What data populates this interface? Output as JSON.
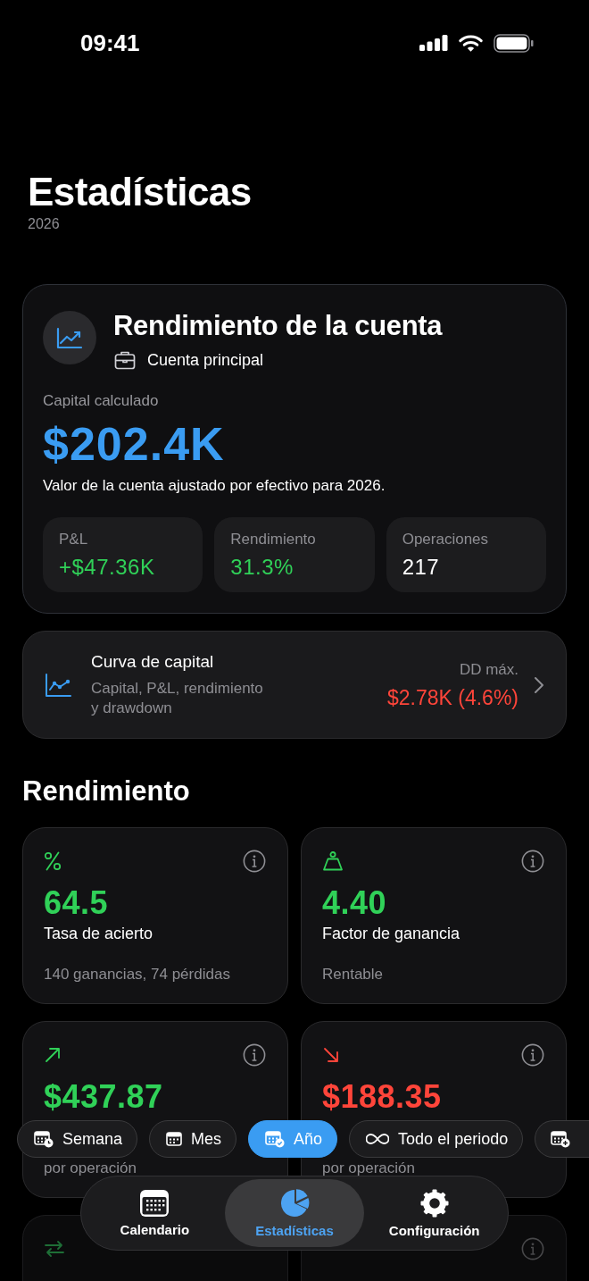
{
  "status_bar": {
    "time": "09:41"
  },
  "header": {
    "title": "Estadísticas",
    "subtitle": "2026"
  },
  "account_card": {
    "title": "Rendimiento de la cuenta",
    "account": "Cuenta principal",
    "capital_label": "Capital calculado",
    "capital_value": "$202.4K",
    "description": "Valor de la cuenta ajustado por efectivo para 2026.",
    "stats": [
      {
        "label": "P&L",
        "value": "+$47.36K",
        "color": "#30d158"
      },
      {
        "label": "Rendimiento",
        "value": "31.3%",
        "color": "#30d158"
      },
      {
        "label": "Operaciones",
        "value": "217",
        "color": "#ffffff"
      }
    ]
  },
  "equity_curve_card": {
    "title": "Curva de capital",
    "subtitle": "Capital, P&L, rendimiento y drawdown",
    "metric_label": "DD máx.",
    "metric_value": "$2.78K (4.6%)"
  },
  "section_title": "Rendimiento",
  "metrics": [
    {
      "kind": "percent",
      "color": "#30d158",
      "value": "64.5",
      "label": "Tasa de acierto",
      "detail": "140 ganancias, 74 pérdidas",
      "info": true
    },
    {
      "kind": "scale",
      "color": "#30d158",
      "value": "4.40",
      "label": "Factor de ganancia",
      "detail": "Rentable",
      "info": true
    },
    {
      "kind": "arrow_up",
      "color": "#30d158",
      "value": "$437.87",
      "detail": "por operación",
      "info": true
    },
    {
      "kind": "arrow_down",
      "color": "#ff453a",
      "value": "$188.35",
      "detail": "por operación",
      "info": true
    },
    {
      "kind": "swap",
      "color": "#1e6e36",
      "info": false
    },
    {
      "info": true
    }
  ],
  "period_filter": [
    {
      "kind": "week",
      "label": "Semana",
      "selected": false
    },
    {
      "kind": "month",
      "label": "Mes",
      "selected": false
    },
    {
      "kind": "year",
      "label": "Año",
      "selected": true
    },
    {
      "kind": "all",
      "label": "Todo el periodo",
      "selected": false
    },
    {
      "kind": "custom",
      "selected": false
    }
  ],
  "tab_bar": [
    {
      "kind": "calendar",
      "label": "Calendario",
      "selected": false
    },
    {
      "kind": "stats",
      "label": "Estadísticas",
      "selected": true
    },
    {
      "kind": "settings",
      "label": "Configuración",
      "selected": false
    }
  ]
}
